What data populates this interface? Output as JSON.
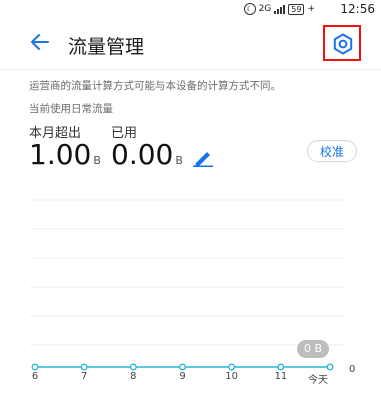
{
  "status_bar": {
    "signal_label": "2G",
    "battery_level": "59",
    "time": "12:56"
  },
  "header": {
    "title": "流量管理"
  },
  "info": {
    "note": "运营商的流量计算方式可能与本设备的计算方式不同。",
    "plan_label": "当前使用日常流量"
  },
  "usage": {
    "exceeded_label": "本月超出",
    "exceeded_value": "1.00",
    "exceeded_unit": "B",
    "used_label": "已用",
    "used_value": "0.00",
    "used_unit": "B"
  },
  "buttons": {
    "calibrate": "校准"
  },
  "chart_data": {
    "type": "line",
    "categories": [
      "6",
      "7",
      "8",
      "9",
      "10",
      "11",
      "今天"
    ],
    "series": [
      {
        "values": [
          0,
          0,
          0,
          0,
          0,
          0,
          0
        ]
      }
    ],
    "ylabel": "",
    "y_tick": "0",
    "tooltip": "0 B",
    "colors": {
      "line": "#29b6d8"
    }
  }
}
